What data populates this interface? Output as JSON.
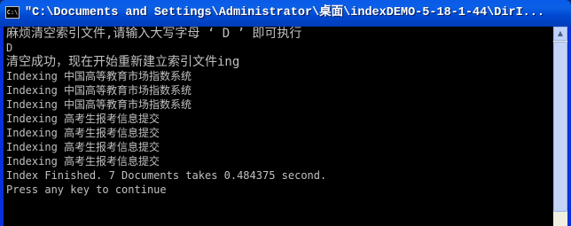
{
  "window": {
    "title": "\"C:\\Documents and Settings\\Administrator\\桌面\\indexDEMO-5-18-1-44\\DirI...",
    "icon": "console-app-icon",
    "icon_label": "C:\\"
  },
  "console": {
    "lines": [
      "麻烦清空索引文件,请输入大写字母 ‘ D ’ 即可执行",
      "D",
      "清空成功，现在开始重新建立索引文件ing",
      "Indexing 中国高等教育市场指数系统",
      "Indexing 中国高等教育市场指数系统",
      "Indexing 中国高等教育市场指数系统",
      "Indexing 高考生报考信息提交",
      "Indexing 高考生报考信息提交",
      "Indexing 高考生报考信息提交",
      "Indexing 高考生报考信息提交",
      "Index Finished. 7 Documents takes 0.484375 second.",
      "Press any key to continue"
    ]
  },
  "colors": {
    "title_bar": "#0054e3",
    "console_bg": "#000000",
    "console_text": "#c0c0c0"
  }
}
